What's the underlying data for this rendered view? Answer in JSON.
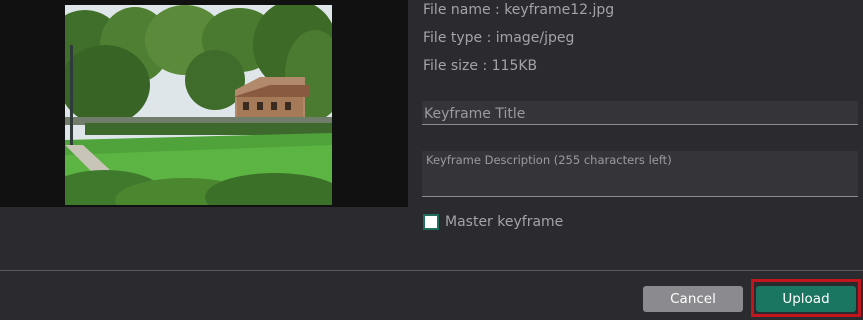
{
  "preview": {
    "image_alt": "keyframe12.jpg"
  },
  "file_info": {
    "name": "File name : keyframe12.jpg",
    "type": "File type : image/jpeg",
    "size": "File size : 115KB"
  },
  "form": {
    "title_placeholder": "Keyframe Title",
    "description_placeholder": "Keyframe Description (255 characters left)",
    "master_label": "Master keyframe",
    "master_checked": false
  },
  "actions": {
    "cancel_label": "Cancel",
    "upload_label": "Upload"
  },
  "colors": {
    "background": "#2b2b2f",
    "upload": "#1a7660",
    "cancel": "#8b8b8f",
    "highlight": "#c2161f"
  }
}
